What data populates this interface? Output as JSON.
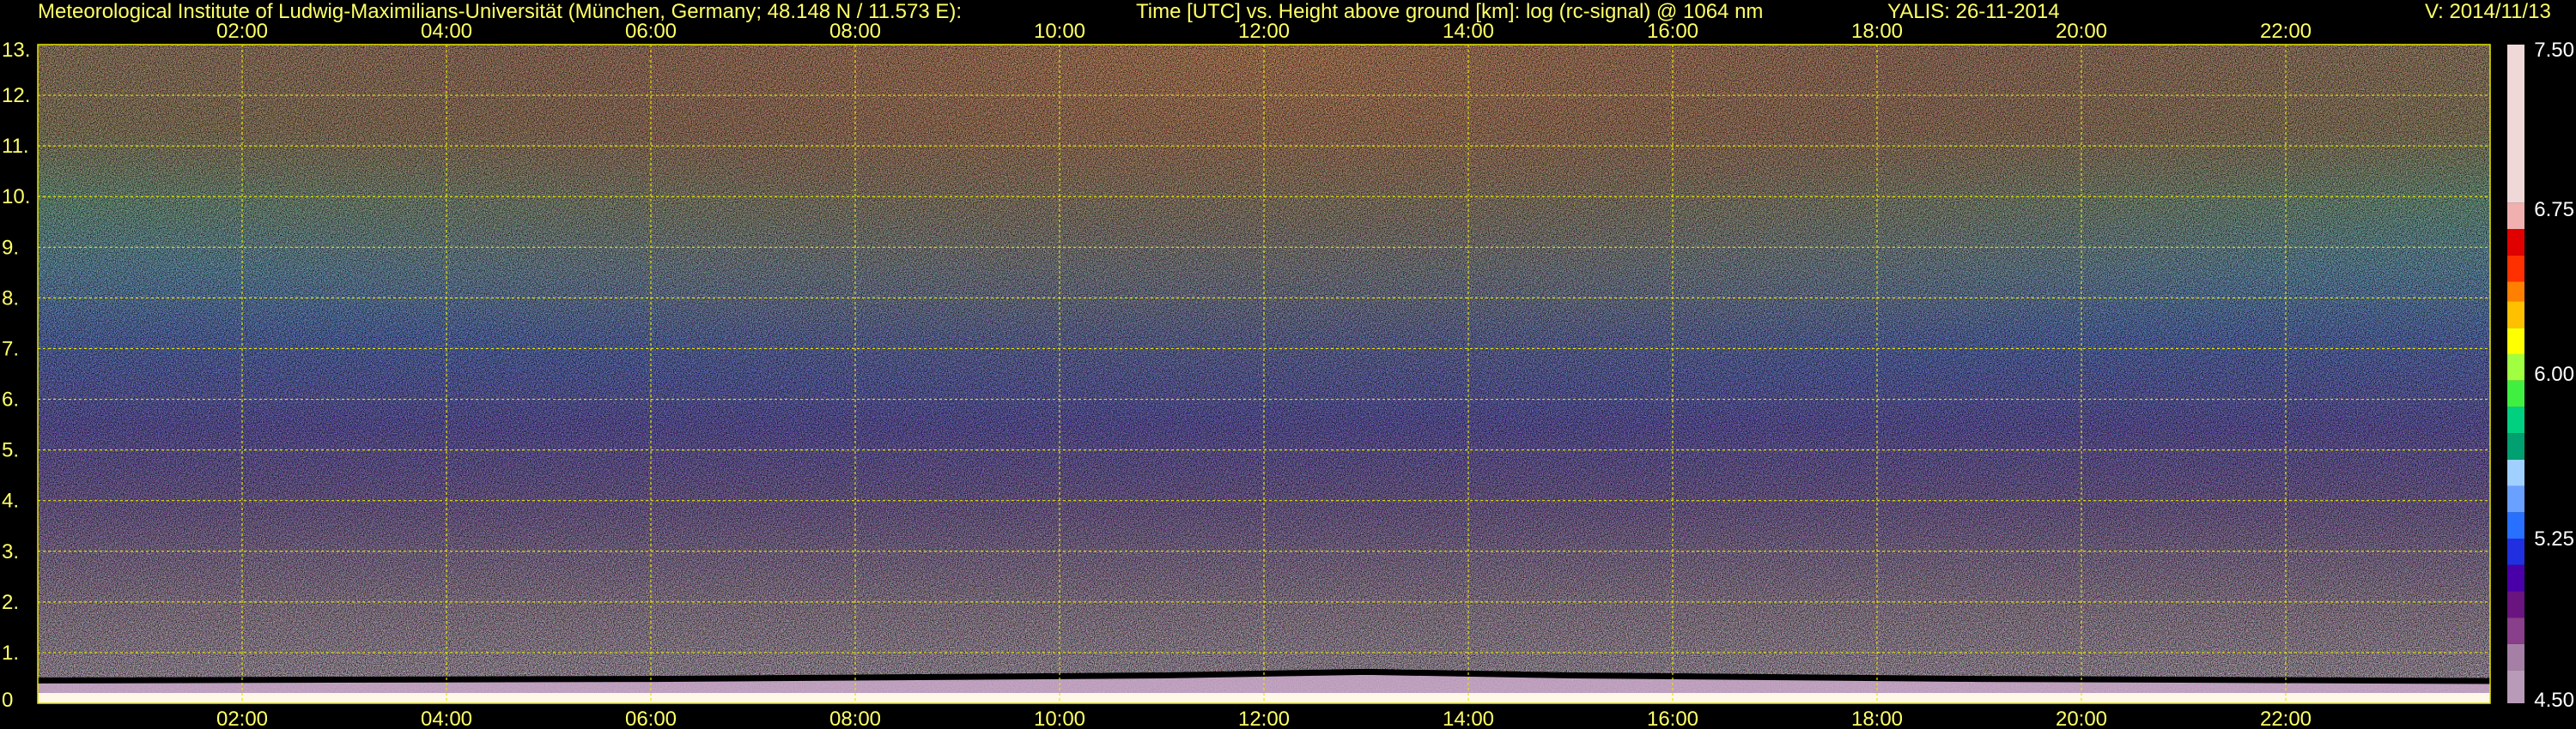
{
  "header": {
    "institute": "Meteorological Institute of Ludwig-Maximilians-Universität (München, Germany; 48.148 N / 11.573 E):",
    "axis_description": "Time [UTC] vs. Height above ground [km]: log (rc-signal) @ 1064 nm",
    "instrument": "YALIS: 26-11-2014",
    "version": "V: 2014/11/13"
  },
  "colors": {
    "text": "#ffff66",
    "grid": "#e6e600",
    "background": "#000000",
    "colorbar": [
      "#b89bb8",
      "#a67fa6",
      "#8a3f8a",
      "#6a1480",
      "#4a00a8",
      "#2030e0",
      "#2870ff",
      "#6aa0ff",
      "#a0d0ff",
      "#00a070",
      "#00d080",
      "#40f040",
      "#a0ff40",
      "#ffff00",
      "#ffc000",
      "#ff8000",
      "#ff3000",
      "#e00000",
      "#f0b0b0",
      "#f0d8d8",
      "#ffffff"
    ]
  },
  "chart_data": {
    "type": "heatmap",
    "title": "Time [UTC] vs. Height above ground [km]: log (rc-signal) @ 1064 nm",
    "x": {
      "label": "Time [UTC]",
      "range_hours": [
        0,
        24
      ],
      "ticks": [
        "02:00",
        "04:00",
        "06:00",
        "08:00",
        "10:00",
        "12:00",
        "14:00",
        "16:00",
        "18:00",
        "20:00",
        "22:00"
      ],
      "tick_hours": [
        2,
        4,
        6,
        8,
        10,
        12,
        14,
        16,
        18,
        20,
        22
      ]
    },
    "y": {
      "label": "Height above ground [km]",
      "range_km": [
        0,
        13
      ],
      "tick_labels": [
        "0",
        "1.",
        "2.",
        "3.",
        "4.",
        "5.",
        "6.",
        "7.",
        "8.",
        "9.",
        "10.",
        "11.",
        "12.",
        "13."
      ],
      "tick_values": [
        0,
        1,
        2,
        3,
        4,
        5,
        6,
        7,
        8,
        9,
        10,
        11,
        12,
        13
      ]
    },
    "colorbar": {
      "range": [
        4.5,
        7.5
      ],
      "tick_labels": [
        "4.50",
        "5.25",
        "6.00",
        "6.75",
        "7.50"
      ],
      "tick_values": [
        4.5,
        5.25,
        6.0,
        6.75,
        7.5
      ]
    },
    "grid": true,
    "features": {
      "boundary_layer_top_km": [
        {
          "hour": 0.0,
          "km": 0.45
        },
        {
          "hour": 6.0,
          "km": 0.48
        },
        {
          "hour": 11.0,
          "km": 0.55
        },
        {
          "hour": 13.0,
          "km": 0.62
        },
        {
          "hour": 15.0,
          "km": 0.55
        },
        {
          "hour": 19.0,
          "km": 0.48
        },
        {
          "hour": 24.0,
          "km": 0.44
        }
      ]
    }
  }
}
